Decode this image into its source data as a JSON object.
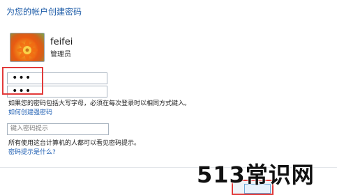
{
  "header": {
    "title": "为您的帐户创建密码"
  },
  "user": {
    "name": "feifei",
    "role": "管理员"
  },
  "passwords": {
    "new_value": "•••",
    "confirm_value": "•••"
  },
  "help": {
    "info": "如果您的密码包括大写字母，必须在每次登录时以相同方式键入。",
    "create_strong_link": "如何创建强密码"
  },
  "hint": {
    "placeholder": "键入密码提示",
    "note": "所有使用这台计算机的人都可以看见密码提示。",
    "what_is_link": "密码提示是什么?"
  },
  "watermark": {
    "text": "513常识网"
  },
  "colors": {
    "accent": "#1e5ca8",
    "link": "#1f5fb3",
    "highlight_box": "#e23a3a"
  }
}
